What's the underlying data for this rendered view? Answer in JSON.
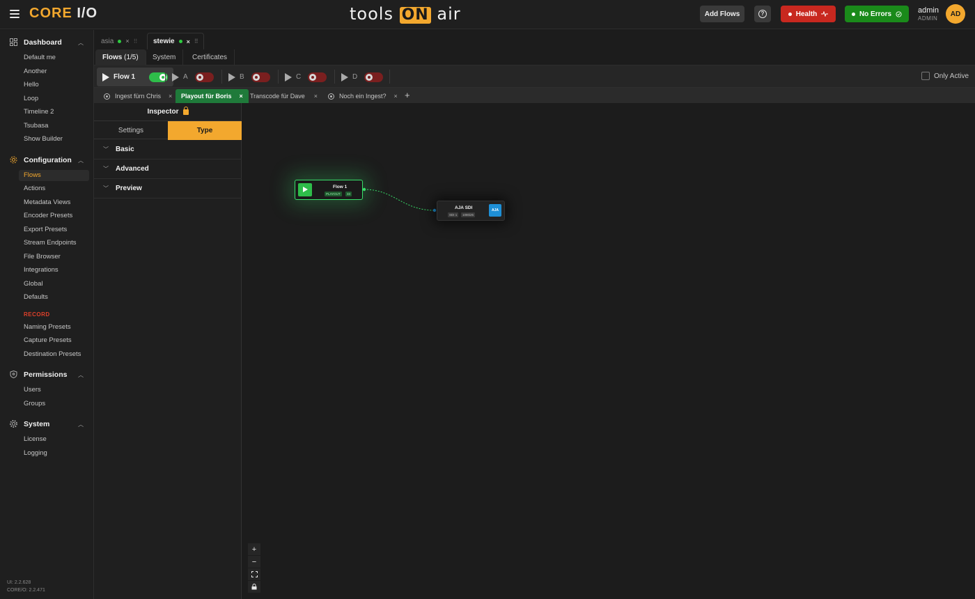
{
  "topbar": {
    "brand_core": "CORE",
    "brand_io": "I/O",
    "center_logo_left": "tools",
    "center_logo_on": "ON",
    "center_logo_right": "air",
    "add_flows": "Add Flows",
    "help_glyph": "?",
    "health": "Health",
    "no_errors": "No Errors",
    "user_name": "admin",
    "user_role": "ADMIN",
    "avatar_initials": "AD",
    "health_color": "#c8281f",
    "ok_color": "#1a8a1a",
    "accent_color": "#f3a82e"
  },
  "sidebar": {
    "dashboard": {
      "label": "Dashboard",
      "icon": "dashboard-icon",
      "items": [
        "Default me",
        "Another",
        "Hello",
        "Loop",
        "Timeline 2",
        "Tsubasa",
        "Show Builder"
      ]
    },
    "configuration": {
      "label": "Configuration",
      "icon": "config-icon",
      "items": [
        "Flows",
        "Actions",
        "Metadata Views",
        "Encoder Presets",
        "Export Presets",
        "Stream Endpoints",
        "File Browser",
        "Integrations",
        "Global",
        "Defaults"
      ],
      "active": "Flows",
      "record_label": "RECORD",
      "record_items": [
        "Naming Presets",
        "Capture Presets",
        "Destination Presets"
      ]
    },
    "permissions": {
      "label": "Permissions",
      "icon": "shield-icon",
      "items": [
        "Users",
        "Groups"
      ]
    },
    "system": {
      "label": "System",
      "icon": "gear-icon",
      "items": [
        "License",
        "Logging"
      ]
    },
    "version_ui": "UI: 2.2.628",
    "version_core": "CORE/O: 2.2.471"
  },
  "server_tabs": [
    {
      "label": "asia",
      "status": "online"
    },
    {
      "label": "stewie",
      "status": "online",
      "active": true
    }
  ],
  "sub_tabs": {
    "flows_label": "Flows",
    "flows_count": "(1/5)",
    "system": "System",
    "certificates": "Certificates"
  },
  "flowbar": {
    "flows": [
      {
        "name": "Flow 1",
        "enabled": true,
        "active": true
      },
      {
        "name": "A",
        "enabled": false
      },
      {
        "name": "B",
        "enabled": false
      },
      {
        "name": "C",
        "enabled": false
      },
      {
        "name": "D",
        "enabled": false
      }
    ],
    "only_active": "Only Active"
  },
  "pipeline_tabs": [
    {
      "label": "Ingest fürn Chris"
    },
    {
      "label": "Playout für Boris",
      "active": true
    },
    {
      "label": "Transcode für Dave"
    },
    {
      "label": "Noch ein Ingest?"
    }
  ],
  "inspector": {
    "title": "Inspector",
    "tab_settings": "Settings",
    "tab_type": "Type",
    "sections": [
      "Basic",
      "Advanced",
      "Preview"
    ]
  },
  "canvas": {
    "flow_node": {
      "title": "Flow 1",
      "chip1": "PLAYOUT",
      "chip2": "33"
    },
    "aja_node": {
      "title": "AJA SDI",
      "chip1": "SDI 1",
      "chip2": "1080i25",
      "logo": "AJA"
    },
    "zoom": [
      "+",
      "−",
      "⛶",
      "🔒"
    ]
  }
}
